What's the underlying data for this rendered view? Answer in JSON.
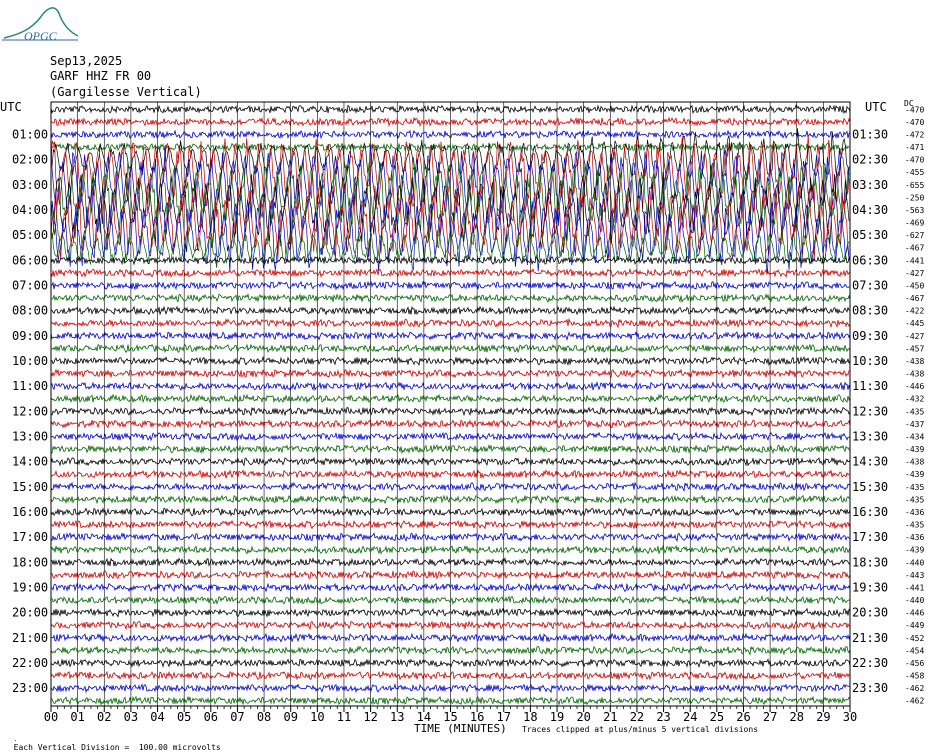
{
  "logo_text": "OPGC",
  "header": {
    "date": "Sep13,2025",
    "station": "GARF HHZ FR 00",
    "location": "(Gargilesse Vertical)"
  },
  "chart_data": {
    "type": "line",
    "left_axis_label": "UTC",
    "right_axis_label": "UTC",
    "dc_label": "DC",
    "left_time_labels": [
      "01:00",
      "02:00",
      "03:00",
      "04:00",
      "05:00",
      "06:00",
      "07:00",
      "08:00",
      "09:00",
      "10:00",
      "11:00",
      "12:00",
      "13:00",
      "14:00",
      "15:00",
      "16:00",
      "17:00",
      "18:00",
      "19:00",
      "20:00",
      "21:00",
      "22:00",
      "23:00"
    ],
    "right_time_labels": [
      "01:30",
      "02:30",
      "03:30",
      "04:30",
      "05:30",
      "06:30",
      "07:30",
      "08:30",
      "09:30",
      "10:30",
      "11:30",
      "12:30",
      "13:30",
      "14:30",
      "15:30",
      "16:30",
      "17:30",
      "18:30",
      "19:30",
      "20:30",
      "21:30",
      "22:30",
      "23:30"
    ],
    "dc_offsets": [
      -470,
      -470,
      -472,
      -471,
      -470,
      -455,
      -655,
      -250,
      -563,
      -469,
      -627,
      -467,
      -441,
      -427,
      -450,
      -467,
      -422,
      -445,
      -427,
      -457,
      -438,
      -438,
      -446,
      -432,
      -435,
      -437,
      -434,
      -439,
      -438,
      -439,
      -435,
      -435,
      -436,
      -435,
      -436,
      -439,
      -440,
      -443,
      -441,
      -440,
      -446,
      -449,
      -452,
      -454,
      -456,
      -458,
      -462,
      -462
    ],
    "x_ticks": [
      "00",
      "01",
      "02",
      "03",
      "04",
      "05",
      "06",
      "07",
      "08",
      "09",
      "10",
      "11",
      "12",
      "13",
      "14",
      "15",
      "16",
      "17",
      "18",
      "19",
      "20",
      "21",
      "22",
      "23",
      "24",
      "25",
      "26",
      "27",
      "28",
      "29",
      "30"
    ],
    "x_title": "TIME (MINUTES)",
    "trace_colors": [
      "#000000",
      "#cc0000",
      "#0000cc",
      "#006600"
    ],
    "rows": 48,
    "x_range": [
      0,
      30
    ],
    "quake_event_minute": 20.2,
    "disturbed_rows": [
      4,
      11
    ]
  },
  "footer": {
    "left": "Each Vertical Division =  100.00 microvolts",
    "right": "Traces clipped at plus/minus 5 vertical divisions"
  }
}
